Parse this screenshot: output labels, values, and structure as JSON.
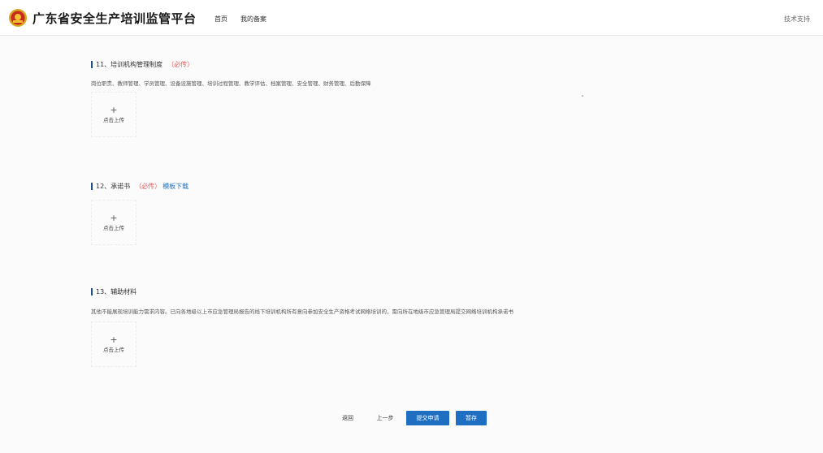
{
  "header": {
    "site_title": "广东省安全生产培训监管平台",
    "nav": [
      "首页",
      "我的备案"
    ],
    "tech_support": "技术支持"
  },
  "sections": [
    {
      "number_title": "11、培训机构管理制度",
      "required": "（必传）",
      "description": "岗位职责、教师管理、学员管理、设备设施管理、培训过程管理、教学评估、档案管理、安全管理、财务管理、后勤保障",
      "upload": {
        "plus": "+",
        "label": "点击上传"
      }
    },
    {
      "number_title": "12、承诺书",
      "required": "（必传）",
      "template_link": "模板下载",
      "upload": {
        "plus": "+",
        "label": "点击上传"
      }
    },
    {
      "number_title": "13、辅助材料",
      "description": "其他不能展现培训能力需求内容。已向各地级以上市应急管理局报告的线下培训机构所有意向参加安全生产资格考试网络培训的，需向所在地级市应急管理局提交网络培训机构承诺书",
      "upload": {
        "plus": "+",
        "label": "点击上传"
      }
    }
  ],
  "actions": {
    "back": "返回",
    "prev": "上一步",
    "submit": "提交申请",
    "save": "暂存"
  },
  "colors": {
    "primary": "#1e6fc1",
    "required": "#e05a5a",
    "link": "#1a73c8",
    "section_bar": "#1f4e8c"
  }
}
